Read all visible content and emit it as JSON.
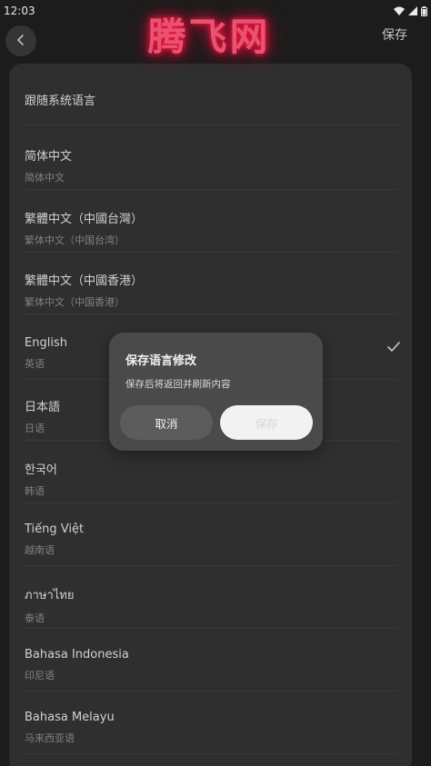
{
  "status_bar": {
    "time": "12:03"
  },
  "header": {
    "save_label": "保存",
    "logo_text": "腾飞网"
  },
  "languages": [
    {
      "name": "跟随系统语言",
      "sub": ""
    },
    {
      "name": "简体中文",
      "sub": "简体中文"
    },
    {
      "name": "繁體中文（中國台灣）",
      "sub": "繁体中文（中国台湾）"
    },
    {
      "name": "繁體中文（中國香港）",
      "sub": "繁体中文（中国香港）"
    },
    {
      "name": "English",
      "sub": "英语",
      "selected": true
    },
    {
      "name": "日本語",
      "sub": "日语"
    },
    {
      "name": "한국어",
      "sub": "韩语"
    },
    {
      "name": "Tiếng Việt",
      "sub": "越南语"
    },
    {
      "name": "ภาษาไทย",
      "sub": "泰语"
    },
    {
      "name": "Bahasa Indonesia",
      "sub": "印尼语"
    },
    {
      "name": "Bahasa Melayu",
      "sub": "马来西亚语"
    }
  ],
  "dialog": {
    "title": "保存语言修改",
    "message": "保存后将返回并刷新内容",
    "cancel_label": "取消",
    "save_label": "保存"
  },
  "icons": {
    "back": "chevron-left-icon",
    "check": "check-icon",
    "wifi": "wifi-icon",
    "signal": "signal-icon",
    "battery": "battery-icon"
  }
}
